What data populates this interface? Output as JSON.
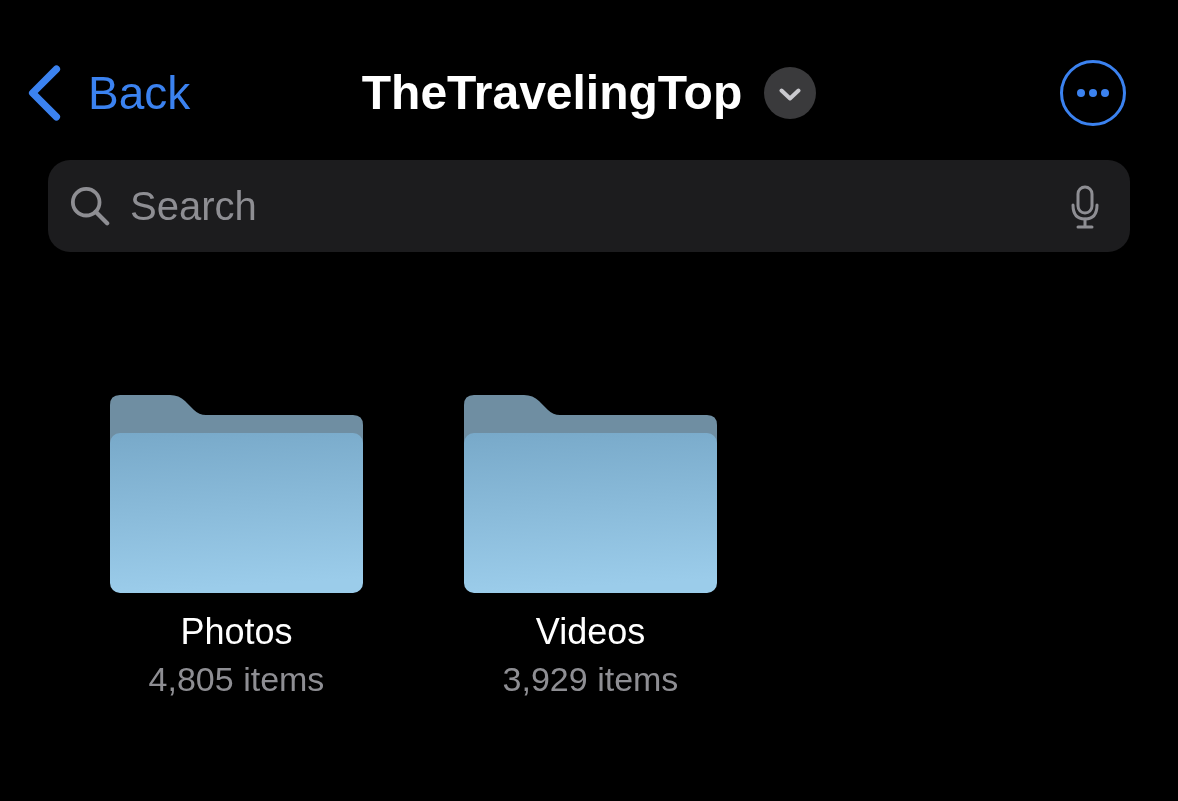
{
  "nav": {
    "back": "Back",
    "title": "TheTravelingTop"
  },
  "search": {
    "placeholder": "Search"
  },
  "folders": [
    {
      "name": "Photos",
      "count": "4,805 items"
    },
    {
      "name": "Videos",
      "count": "3,929 items"
    }
  ]
}
